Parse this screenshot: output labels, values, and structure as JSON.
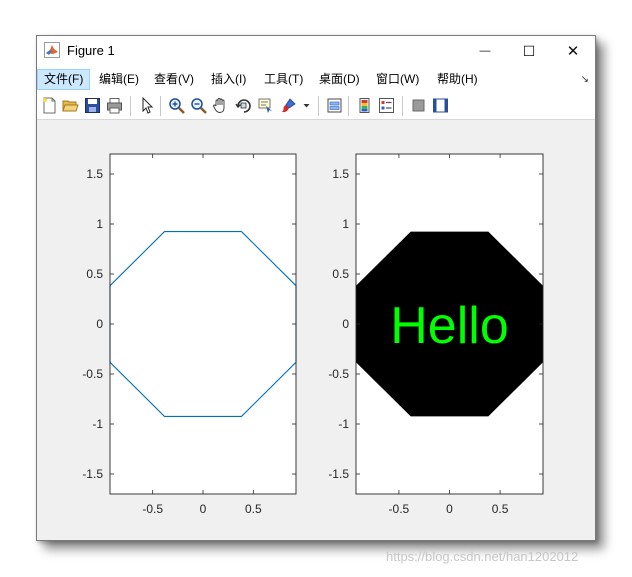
{
  "window": {
    "title": "Figure 1",
    "minimize_glyph": "—",
    "maximize_glyph": "☐",
    "close_glyph": "✕"
  },
  "menu": {
    "items": [
      "文件(F)",
      "编辑(E)",
      "查看(V)",
      "插入(I)",
      "工具(T)",
      "桌面(D)",
      "窗口(W)",
      "帮助(H)"
    ],
    "active_index": 0,
    "overflow_glyph": "↘"
  },
  "toolbar": {
    "icons": [
      "new-file-icon",
      "open-folder-icon",
      "save-icon",
      "print-icon",
      "pointer-icon",
      "zoom-in-icon",
      "zoom-out-icon",
      "pan-hand-icon",
      "rotate-3d-icon",
      "data-cursor-icon",
      "brush-icon",
      "brush-dropdown-icon",
      "link-plot-icon",
      "colorbar-icon",
      "legend-icon",
      "hide-plot-tools-icon",
      "show-plot-tools-icon"
    ]
  },
  "colors": {
    "outline_octagon": "#0072bd",
    "filled_octagon": "#000000",
    "hello_text": "#00ff00",
    "axes_bg": "#ffffff",
    "figure_bg": "#f0f0f0"
  },
  "chart_data": [
    {
      "type": "polygon",
      "shape": "octagon",
      "fill": "none",
      "vertices": [
        [
          0.924,
          0.383
        ],
        [
          0.383,
          0.924
        ],
        [
          -0.383,
          0.924
        ],
        [
          -0.924,
          0.383
        ],
        [
          -0.924,
          -0.383
        ],
        [
          -0.383,
          -0.924
        ],
        [
          0.383,
          -0.924
        ],
        [
          0.924,
          -0.383
        ]
      ],
      "xlim": [
        -0.924,
        0.924
      ],
      "ylim": [
        -1.7,
        1.7
      ],
      "xticks": [
        "-0.5",
        "0",
        "0.5"
      ],
      "yticks": [
        "1.5",
        "1",
        "0.5",
        "0",
        "-0.5",
        "-1",
        "-1.5"
      ],
      "grid": false
    },
    {
      "type": "polygon",
      "shape": "octagon",
      "fill": "#000000",
      "vertices": [
        [
          0.924,
          0.383
        ],
        [
          0.383,
          0.924
        ],
        [
          -0.383,
          0.924
        ],
        [
          -0.924,
          0.383
        ],
        [
          -0.924,
          -0.383
        ],
        [
          -0.383,
          -0.924
        ],
        [
          0.383,
          -0.924
        ],
        [
          0.924,
          -0.383
        ]
      ],
      "annotation": {
        "text": "Hello",
        "x": 0,
        "y": 0
      },
      "xlim": [
        -0.924,
        0.924
      ],
      "ylim": [
        -1.7,
        1.7
      ],
      "xticks": [
        "-0.5",
        "0",
        "0.5"
      ],
      "yticks": [
        "1.5",
        "1",
        "0.5",
        "0",
        "-0.5",
        "-1",
        "-1.5"
      ],
      "grid": false
    }
  ],
  "watermark": "https://blog.csdn.net/han1202012"
}
